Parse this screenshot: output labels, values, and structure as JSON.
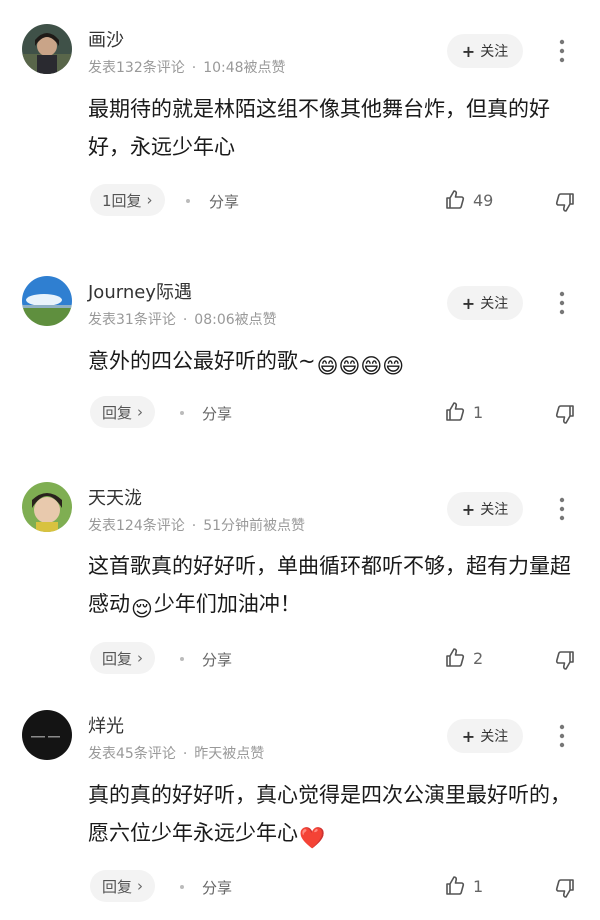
{
  "follow_label": "关注",
  "share_label": "分享",
  "comments": [
    {
      "username": "画沙",
      "meta_count": "发表132条评论",
      "meta_time": "10:48被点赞",
      "text": "最期待的就是林陌这组不像其他舞台炸，但真的好好，永远少年心",
      "reply_label": "1回复",
      "likes": "49"
    },
    {
      "username": "Journey际遇",
      "meta_count": "发表31条评论",
      "meta_time": "08:06被点赞",
      "text": "意外的四公最好听的歌~",
      "emoji_trailing": "😄😄😄😄",
      "reply_label": "回复",
      "likes": "1"
    },
    {
      "username": "天天泷",
      "meta_count": "发表124条评论",
      "meta_time": "51分钟前被点赞",
      "text_a": "这首歌真的好好听，单曲循环都听不够，超有力量超感动",
      "emoji_mid": "😌",
      "text_b": "少年们加油冲！",
      "reply_label": "回复",
      "likes": "2"
    },
    {
      "username": "烊光",
      "meta_count": "发表45条评论",
      "meta_time": "昨天被点赞",
      "text": "真的真的好好听，真心觉得是四次公演里最好听的，愿六位少年永远少年心",
      "emoji_trailing": "❤️",
      "reply_label": "回复",
      "likes": "1"
    }
  ]
}
